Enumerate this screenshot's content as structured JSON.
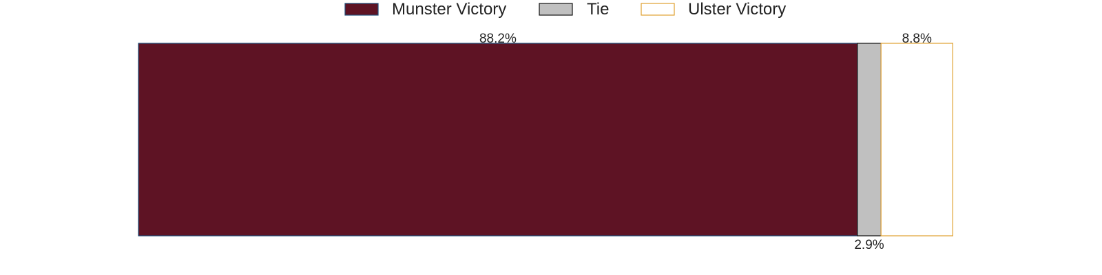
{
  "chart_data": {
    "type": "bar",
    "orientation": "horizontal-stacked",
    "categories": [
      ""
    ],
    "series": [
      {
        "name": "Munster Victory",
        "values": [
          88.2
        ],
        "label": "88.2%",
        "fill": "#5e1324",
        "stroke": "#1f4e79",
        "label_position": "top-center"
      },
      {
        "name": "Tie",
        "values": [
          2.9
        ],
        "label": "2.9%",
        "fill": "#c0c0c0",
        "stroke": "#111111",
        "label_position": "bottom-center"
      },
      {
        "name": "Ulster Victory",
        "values": [
          8.8
        ],
        "label": "8.8%",
        "fill": "#ffffff",
        "stroke": "#e0a030",
        "label_position": "top-center"
      }
    ],
    "xlim": [
      0,
      100
    ],
    "legend": {
      "placement": "top-center",
      "items": [
        {
          "label": "Munster Victory",
          "fill": "#5e1324",
          "stroke": "#1f4e79"
        },
        {
          "label": "Tie",
          "fill": "#c0c0c0",
          "stroke": "#111111"
        },
        {
          "label": "Ulster Victory",
          "fill": "#ffffff",
          "stroke": "#e0a030"
        }
      ]
    },
    "grid": false,
    "axes_visible": false
  }
}
